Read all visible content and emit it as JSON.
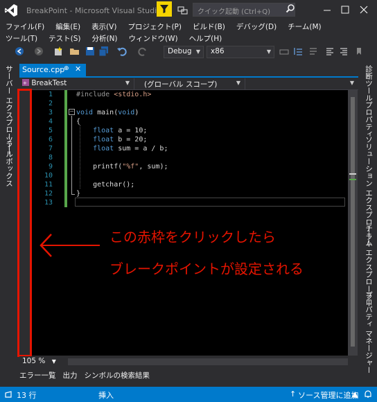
{
  "window": {
    "title": "BreakPoint - Microsoft Visual Studio",
    "quick_launch_placeholder": "クイック起動 (Ctrl+Q)"
  },
  "menu": {
    "row1": [
      "ファイル(F)",
      "編集(E)",
      "表示(V)",
      "プロジェクト(P)",
      "ビルド(B)",
      "デバッグ(D)",
      "チーム(M)"
    ],
    "row2": [
      "ツール(T)",
      "テスト(S)",
      "分析(N)",
      "ウィンドウ(W)",
      "ヘルプ(H)"
    ]
  },
  "toolbar": {
    "configuration": "Debug",
    "platform": "x86"
  },
  "left_strip": {
    "items": [
      "サーバー エクスプローラー",
      "ツールボックス"
    ]
  },
  "right_strip": {
    "items": [
      "診断ツール",
      "プロパティ",
      "ソリューション エクスプローラー",
      "チーム エクスプローラー",
      "プロパティ マネージャー"
    ]
  },
  "tab": {
    "label": "Source.cpp",
    "pin": "⊕",
    "close": "✕"
  },
  "navbar": {
    "project": "BreakTest",
    "scope": "(グローバル スコープ)",
    "member": ""
  },
  "editor": {
    "line_numbers": [
      "1",
      "2",
      "3",
      "4",
      "5",
      "6",
      "7",
      "8",
      "9",
      "10",
      "11",
      "12",
      "13"
    ],
    "lines": {
      "l1_pp": "#include ",
      "l1_hdr": "<stdio.h>",
      "l3_kw": "void",
      "l3_rest": " main(",
      "l3_kw2": "void",
      "l3_end": ")",
      "l4": "{",
      "l5_kw": "float",
      "l5_rest": " a = 10;",
      "l6_kw": "float",
      "l6_rest": " b = 20;",
      "l7_kw": "float",
      "l7_rest": " sum = a / b;",
      "l9_a": "printf(",
      "l9_str": "\"%f\"",
      "l9_b": ", sum);",
      "l11": "getchar();",
      "l12": "}"
    }
  },
  "annotation": {
    "line1": "この赤枠をクリックしたら",
    "line2": "ブレークポイントが設定される",
    "color": "#e51400"
  },
  "zoom": "105 %",
  "output_tabs": [
    "エラー一覧",
    "出力",
    "シンボルの検索結果"
  ],
  "status": {
    "line": "13 行",
    "mode": "挿入",
    "source_control": "ソース管理に追加"
  },
  "colors": {
    "accent": "#007acc",
    "background": "#2d2d30",
    "editor_bg": "#000000",
    "keyword": "#569cd6",
    "line_number": "#2b91af",
    "annotation": "#e51400"
  }
}
